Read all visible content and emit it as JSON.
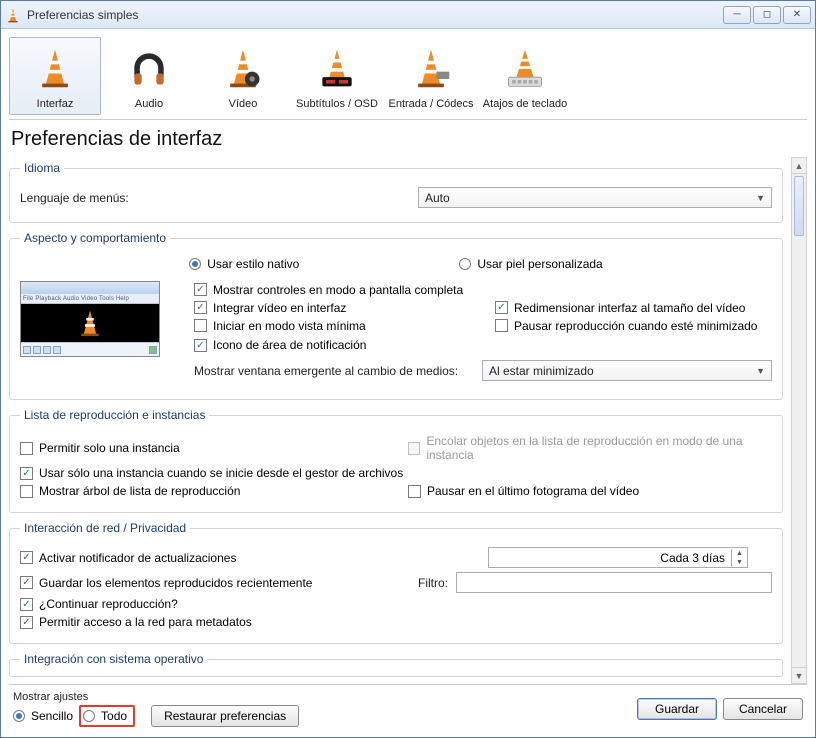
{
  "window": {
    "title": "Preferencias simples"
  },
  "tabs": [
    {
      "label": "Interfaz",
      "active": true
    },
    {
      "label": "Audio"
    },
    {
      "label": "Vídeo"
    },
    {
      "label": "Subtítulos / OSD"
    },
    {
      "label": "Entrada / Códecs"
    },
    {
      "label": "Atajos de teclado"
    }
  ],
  "page_title": "Preferencias de interfaz",
  "sections": {
    "idioma": {
      "legend": "Idioma",
      "menu_label": "Lenguaje de menús:",
      "menu_value": "Auto"
    },
    "aspecto": {
      "legend": "Aspecto y comportamiento",
      "radio_native": "Usar estilo nativo",
      "radio_skin": "Usar piel personalizada",
      "opts": {
        "fullscreen_controls": "Mostrar controles en modo a pantalla completa",
        "embed_video": "Integrar vídeo en interfaz",
        "resize_interface": "Redimensionar interfaz al tamaño del vídeo",
        "minimal_view": "Iniciar en modo vista mínima",
        "pause_minimized": "Pausar reproducción cuando esté minimizado",
        "systray": "Icono de área de notificación",
        "popup_label": "Mostrar ventana emergente al cambio de medios:",
        "popup_value": "Al estar minimizado"
      }
    },
    "playlist": {
      "legend": "Lista de reproducción e instancias",
      "one_instance": "Permitir solo una instancia",
      "enqueue": "Encolar objetos en la lista de reproducción en modo de una instancia",
      "one_instance_fm": "Usar sólo una instancia cuando se inicie desde el gestor de archivos",
      "playlist_tree": "Mostrar árbol de lista de reproducción",
      "pause_last_frame": "Pausar en el último fotograma del vídeo"
    },
    "network": {
      "legend": "Interacción de red / Privacidad",
      "updates": "Activar notificador de actualizaciones",
      "updates_freq": "Cada 3 días",
      "save_recent": "Guardar los elementos reproducidos recientemente",
      "filter_label": "Filtro:",
      "continue_playback": "¿Continuar reproducción?",
      "metadata_access": "Permitir acceso a la red para metadatos"
    },
    "os": {
      "legend": "Integración con sistema operativo"
    }
  },
  "footer": {
    "show_settings_label": "Mostrar ajustes",
    "simple": "Sencillo",
    "all": "Todo",
    "reset": "Restaurar preferencias",
    "save": "Guardar",
    "cancel": "Cancelar"
  }
}
